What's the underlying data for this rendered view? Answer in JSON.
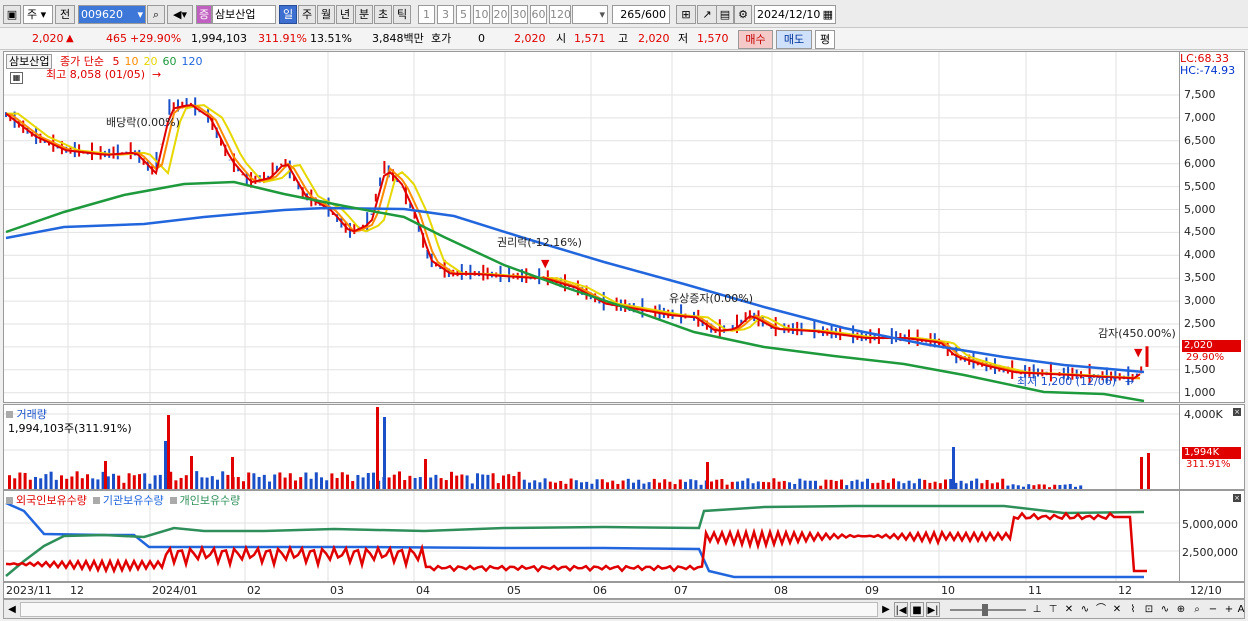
{
  "toolbar": {
    "market": "주",
    "prev_label": "전",
    "stock_code": "009620",
    "search_icon": "search-icon",
    "type_badge": "증",
    "stock_name": "삼보산업",
    "periods": [
      "일",
      "주",
      "월",
      "년",
      "분",
      "초",
      "틱"
    ],
    "active_period": "일",
    "intervals": [
      "1",
      "3",
      "5",
      "10",
      "20",
      "30",
      "60",
      "120"
    ],
    "count": "265",
    "count_max": "/600",
    "date": "2024/12/10"
  },
  "quote": {
    "price": "2,020",
    "change": "465",
    "change_pct": "+29.90%",
    "volume": "1,994,103",
    "volume_pct": "311.91%",
    "turnover_pct": "13.51%",
    "amount": "3,848백만",
    "hoga_label": "호가",
    "hoga_value": "0",
    "hoga_price": "2,020",
    "open_label": "시",
    "open": "1,571",
    "high_label": "고",
    "high": "2,020",
    "low_label": "저",
    "low": "1,570",
    "buy_label": "매수",
    "sell_label": "매도",
    "eval_label": "평"
  },
  "price_panel": {
    "title": "삼보산업",
    "legend_prefix": "종가 단순",
    "ma": [
      {
        "label": "5",
        "color": "#e00000"
      },
      {
        "label": "10",
        "color": "#ff8c00"
      },
      {
        "label": "20",
        "color": "#e6d800"
      },
      {
        "label": "60",
        "color": "#1e9a3c"
      },
      {
        "label": "120",
        "color": "#2266dd"
      }
    ],
    "high_note": "최고 8,058 (01/05)",
    "low_note": "최저 1,200 (12/06)",
    "events": [
      "배당락(0.00%)",
      "권리락(-12.16%)",
      "유상증자(0.00%)",
      "감자(450.00%)"
    ],
    "lc": "LC:68.33",
    "hc": "HC:-74.93",
    "y_ticks": [
      "7,500",
      "7,000",
      "6,500",
      "6,000",
      "5,500",
      "5,000",
      "4,500",
      "4,000",
      "3,500",
      "3,000",
      "2,500",
      "2,000",
      "1,500",
      "1,000"
    ],
    "last_price_tag": "2,020",
    "last_pct_tag": "29.90%"
  },
  "volume_panel": {
    "title": "거래량",
    "value": "1,994,103주(311.91%)",
    "y_ticks": [
      "4,000K"
    ],
    "last_tag": "1,994K",
    "last_pct": "311.91%"
  },
  "holding_panel": {
    "legend": [
      {
        "label": "외국인보유수량",
        "color": "#e00000"
      },
      {
        "label": "기관보유수량",
        "color": "#2266dd"
      },
      {
        "label": "개인보유수량",
        "color": "#2f8f5a"
      }
    ],
    "y_ticks": [
      "5,000,000",
      "2,500,000"
    ]
  },
  "date_axis": [
    "2023/11",
    "12",
    "2024/01",
    "02",
    "03",
    "04",
    "05",
    "06",
    "07",
    "08",
    "09",
    "10",
    "11",
    "12",
    "12/10"
  ],
  "colors": {
    "up": "#e00000",
    "down": "#1a4fc8",
    "accent": "#3d6fd0"
  }
}
